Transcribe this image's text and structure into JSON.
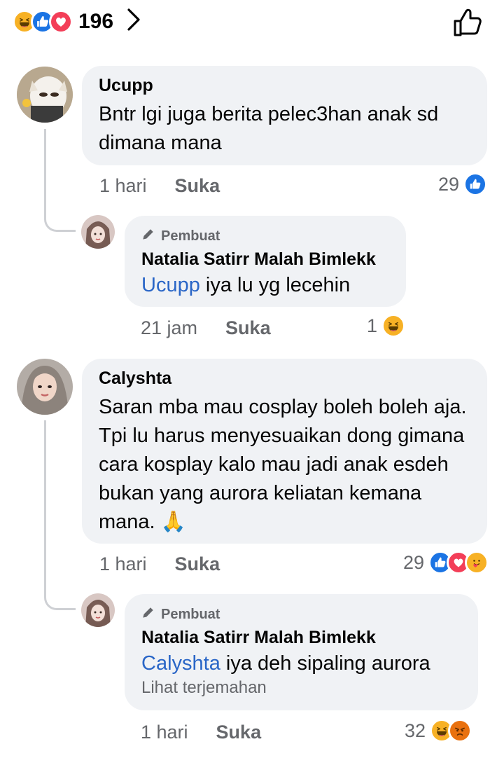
{
  "reaction_summary": {
    "count": "196",
    "icons": [
      "haha-icon",
      "like-icon",
      "love-icon"
    ]
  },
  "comments": [
    {
      "author": "Ucupp",
      "text": "Bntr lgi juga berita pelec3han anak sd dimana mana",
      "time": "1 hari",
      "like_label": "Suka",
      "reaction_count": "29",
      "reactions": [
        "like"
      ],
      "reply": {
        "badge": "Pembuat",
        "author": "Natalia Satirr Malah Bimlekk",
        "mention": "Ucupp",
        "text": " iya lu yg lecehin",
        "time": "21 jam",
        "like_label": "Suka",
        "reaction_count": "1",
        "reactions": [
          "haha"
        ]
      }
    },
    {
      "author": "Calyshta",
      "text": "Saran mba mau cosplay boleh boleh aja. Tpi lu harus menyesuaikan dong gimana cara kosplay kalo mau jadi anak esdeh bukan yang aurora keliatan kemana mana. 🙏",
      "time": "1 hari",
      "like_label": "Suka",
      "reaction_count": "29",
      "reactions": [
        "like",
        "love",
        "care"
      ],
      "reply": {
        "badge": "Pembuat",
        "author": "Natalia Satirr Malah Bimlekk",
        "mention": "Calyshta",
        "text": " iya deh sipaling aurora",
        "see_translation": "Lihat terjemahan",
        "time": "1 hari",
        "like_label": "Suka",
        "reaction_count": "32",
        "reactions": [
          "haha",
          "angry"
        ]
      }
    }
  ],
  "colors": {
    "bubble": "#f0f2f5",
    "meta": "#65676b",
    "mention": "#2a66c7",
    "like_blue": "#1b74e4",
    "love_red": "#f33e58",
    "haha_yellow": "#f7b125"
  }
}
